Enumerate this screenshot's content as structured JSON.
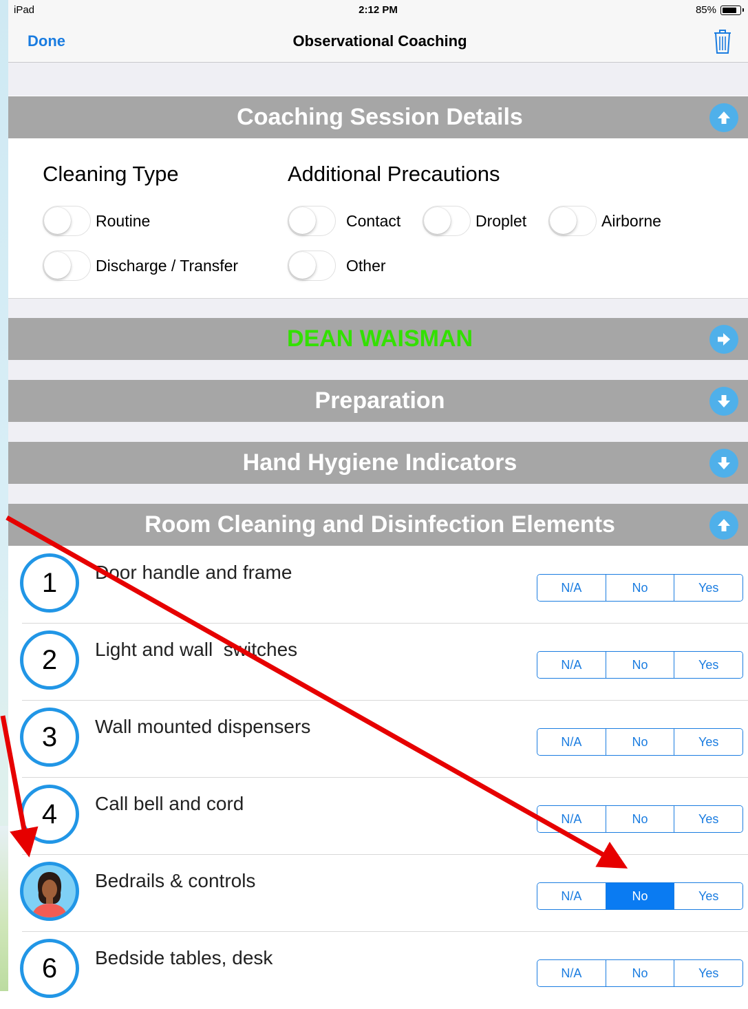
{
  "status_bar": {
    "device": "iPad",
    "time": "2:12 PM",
    "battery": "85%",
    "battery_level": 0.85
  },
  "nav": {
    "done_label": "Done",
    "title": "Observational Coaching",
    "trash_icon": "trash-icon"
  },
  "colors": {
    "header_bg": "#a6a6a6",
    "accent": "#1a7ce0",
    "arrow_bg": "#4fb0ea",
    "name_green": "#33e000",
    "annotation_red": "#e60000"
  },
  "sections": {
    "details": {
      "title": "Coaching Session Details",
      "icon": "arrow-up-icon"
    },
    "coach": {
      "title": "DEAN WAISMAN",
      "icon": "arrow-right-icon"
    },
    "preparation": {
      "title": "Preparation",
      "icon": "arrow-down-icon"
    },
    "hand_hygiene": {
      "title": "Hand Hygiene Indicators",
      "icon": "arrow-down-icon"
    },
    "room_cleaning": {
      "title": "Room Cleaning and Disinfection Elements",
      "icon": "arrow-up-icon"
    }
  },
  "cleaning_type": {
    "heading": "Cleaning Type",
    "options": [
      {
        "label": "Routine",
        "on": false
      },
      {
        "label": "Discharge / Transfer",
        "on": false
      }
    ]
  },
  "precautions": {
    "heading": "Additional Precautions",
    "options": [
      {
        "label": "Contact",
        "on": false
      },
      {
        "label": "Droplet",
        "on": false
      },
      {
        "label": "Airborne",
        "on": false
      },
      {
        "label": "Other",
        "on": false
      }
    ]
  },
  "elements": [
    {
      "number": "1",
      "label": "Door handle and frame",
      "options": [
        "N/A",
        "No",
        "Yes"
      ],
      "selected": null
    },
    {
      "number": "2",
      "label": "Light and wall  switches",
      "options": [
        "N/A",
        "No",
        "Yes"
      ],
      "selected": null
    },
    {
      "number": "3",
      "label": "Wall mounted dispensers",
      "options": [
        "N/A",
        "No",
        "Yes"
      ],
      "selected": null
    },
    {
      "number": "4",
      "label": "Call bell and cord",
      "options": [
        "N/A",
        "No",
        "Yes"
      ],
      "selected": null
    },
    {
      "number": "",
      "avatar": "person-avatar-icon",
      "label": "Bedrails & controls",
      "options": [
        "N/A",
        "No",
        "Yes"
      ],
      "selected": "No"
    },
    {
      "number": "6",
      "label": "Bedside tables, desk",
      "options": [
        "N/A",
        "No",
        "Yes"
      ],
      "selected": null
    }
  ]
}
